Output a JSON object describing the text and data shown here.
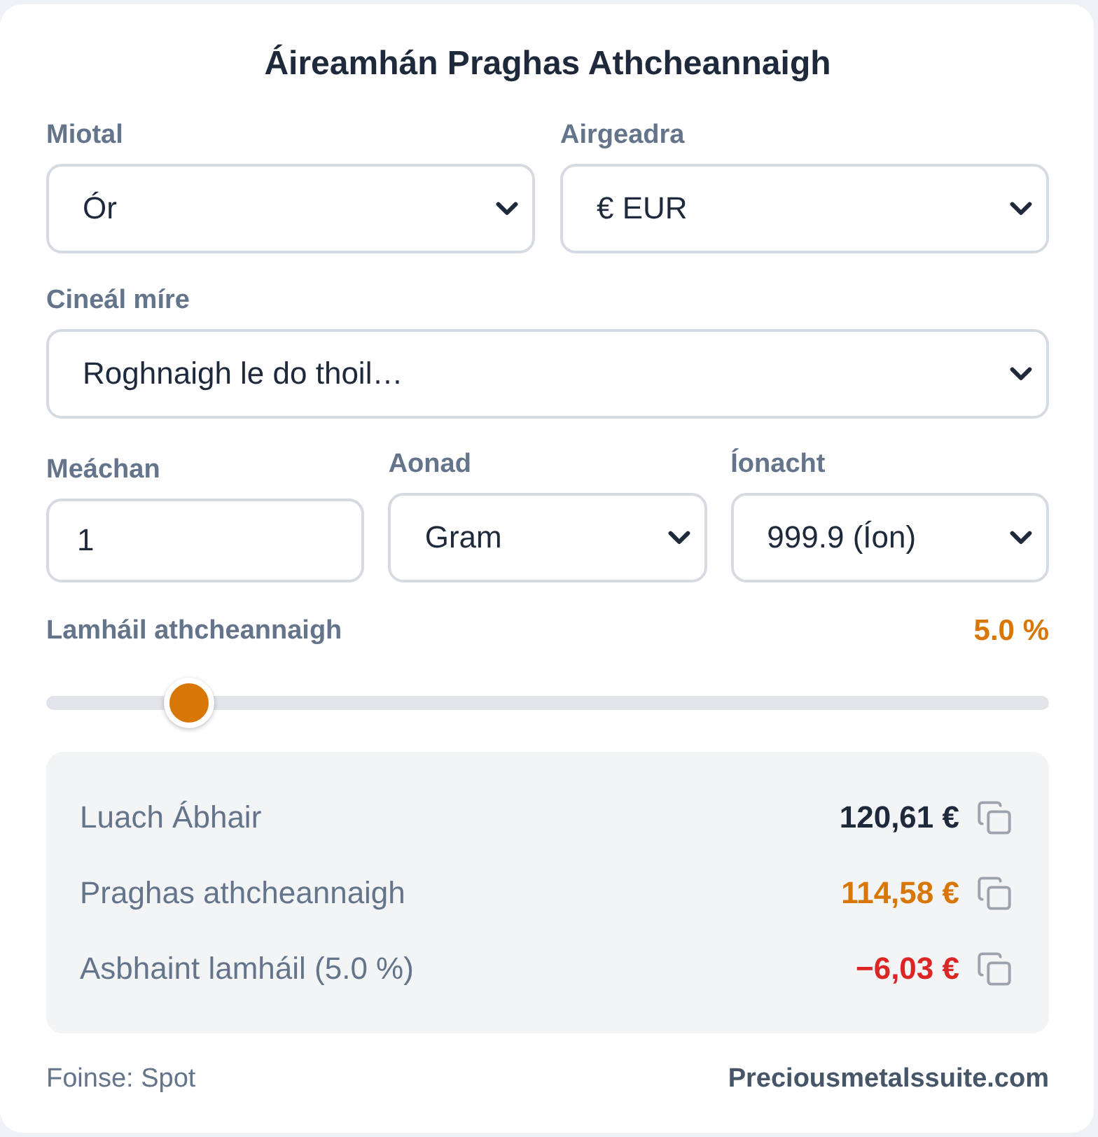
{
  "title": "Áireamhán Praghas Athcheannaigh",
  "field_rows": [
    [
      {
        "label": "Miotal",
        "kind": "select",
        "value": "Ór"
      },
      {
        "label": "Airgeadra",
        "kind": "select",
        "value": "€ EUR"
      }
    ],
    [
      {
        "label": "Cineál míre",
        "kind": "select",
        "value": "Roghnaigh le do thoil…"
      }
    ],
    [
      {
        "label": "Meáchan",
        "kind": "input",
        "value": "1"
      },
      {
        "label": "Aonad",
        "kind": "select",
        "value": "Gram"
      },
      {
        "label": "Íonacht",
        "kind": "select",
        "value": "999.9 (Íon)"
      }
    ]
  ],
  "allowance": {
    "label": "Lamháil athcheannaigh",
    "reading": "5.0 %",
    "level": 0.143
  },
  "results": [
    {
      "label": "Luach Ábhair",
      "value": "120,61 €",
      "color": "#1e293b"
    },
    {
      "label": "Praghas athcheannaigh",
      "value": "114,58 €",
      "color": "#d97706"
    },
    {
      "label": "Asbhaint lamháil (5.0 %)",
      "value": "−6,03 €",
      "color": "#dc2626"
    }
  ],
  "footer": {
    "source": "Foinse: Spot",
    "site": "Preciousmetalssuite.com"
  }
}
